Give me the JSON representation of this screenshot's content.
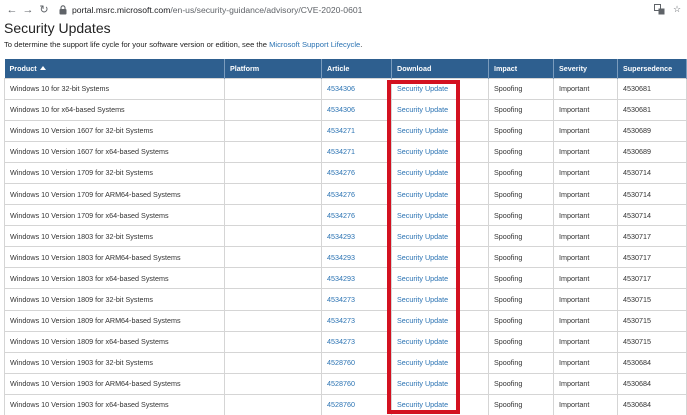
{
  "browser": {
    "url_host": "portal.msrc.microsoft.com",
    "url_path": "/en-us/security-guidance/advisory/CVE-2020-0601"
  },
  "page": {
    "title": "Security Updates",
    "lifecycle_text": "To determine the support life cycle for your software version or edition, see the ",
    "lifecycle_link": "Microsoft Support Lifecycle",
    "lifecycle_end": "."
  },
  "table": {
    "headers": [
      "Product",
      "Platform",
      "Article",
      "Download",
      "Impact",
      "Severity",
      "Supersedence"
    ],
    "rows": [
      {
        "product": "Windows 10 for 32-bit Systems",
        "platform": "",
        "article": "4534306",
        "download": "Security Update",
        "impact": "Spoofing",
        "severity": "Important",
        "supersedence": "4530681"
      },
      {
        "product": "Windows 10 for x64-based Systems",
        "platform": "",
        "article": "4534306",
        "download": "Security Update",
        "impact": "Spoofing",
        "severity": "Important",
        "supersedence": "4530681"
      },
      {
        "product": "Windows 10 Version 1607 for 32-bit Systems",
        "platform": "",
        "article": "4534271",
        "download": "Security Update",
        "impact": "Spoofing",
        "severity": "Important",
        "supersedence": "4530689"
      },
      {
        "product": "Windows 10 Version 1607 for x64-based Systems",
        "platform": "",
        "article": "4534271",
        "download": "Security Update",
        "impact": "Spoofing",
        "severity": "Important",
        "supersedence": "4530689"
      },
      {
        "product": "Windows 10 Version 1709 for 32-bit Systems",
        "platform": "",
        "article": "4534276",
        "download": "Security Update",
        "impact": "Spoofing",
        "severity": "Important",
        "supersedence": "4530714"
      },
      {
        "product": "Windows 10 Version 1709 for ARM64-based Systems",
        "platform": "",
        "article": "4534276",
        "download": "Security Update",
        "impact": "Spoofing",
        "severity": "Important",
        "supersedence": "4530714"
      },
      {
        "product": "Windows 10 Version 1709 for x64-based Systems",
        "platform": "",
        "article": "4534276",
        "download": "Security Update",
        "impact": "Spoofing",
        "severity": "Important",
        "supersedence": "4530714"
      },
      {
        "product": "Windows 10 Version 1803 for 32-bit Systems",
        "platform": "",
        "article": "4534293",
        "download": "Security Update",
        "impact": "Spoofing",
        "severity": "Important",
        "supersedence": "4530717"
      },
      {
        "product": "Windows 10 Version 1803 for ARM64-based Systems",
        "platform": "",
        "article": "4534293",
        "download": "Security Update",
        "impact": "Spoofing",
        "severity": "Important",
        "supersedence": "4530717"
      },
      {
        "product": "Windows 10 Version 1803 for x64-based Systems",
        "platform": "",
        "article": "4534293",
        "download": "Security Update",
        "impact": "Spoofing",
        "severity": "Important",
        "supersedence": "4530717"
      },
      {
        "product": "Windows 10 Version 1809 for 32-bit Systems",
        "platform": "",
        "article": "4534273",
        "download": "Security Update",
        "impact": "Spoofing",
        "severity": "Important",
        "supersedence": "4530715"
      },
      {
        "product": "Windows 10 Version 1809 for ARM64-based Systems",
        "platform": "",
        "article": "4534273",
        "download": "Security Update",
        "impact": "Spoofing",
        "severity": "Important",
        "supersedence": "4530715"
      },
      {
        "product": "Windows 10 Version 1809 for x64-based Systems",
        "platform": "",
        "article": "4534273",
        "download": "Security Update",
        "impact": "Spoofing",
        "severity": "Important",
        "supersedence": "4530715"
      },
      {
        "product": "Windows 10 Version 1903 for 32-bit Systems",
        "platform": "",
        "article": "4528760",
        "download": "Security Update",
        "impact": "Spoofing",
        "severity": "Important",
        "supersedence": "4530684"
      },
      {
        "product": "Windows 10 Version 1903 for ARM64-based Systems",
        "platform": "",
        "article": "4528760",
        "download": "Security Update",
        "impact": "Spoofing",
        "severity": "Important",
        "supersedence": "4530684"
      },
      {
        "product": "Windows 10 Version 1903 for x64-based Systems",
        "platform": "",
        "article": "4528760",
        "download": "Security Update",
        "impact": "Spoofing",
        "severity": "Important",
        "supersedence": "4530684"
      }
    ]
  },
  "colors": {
    "header_bg": "#2e5f8f",
    "link": "#2b73b3",
    "highlight": "#d31120"
  }
}
